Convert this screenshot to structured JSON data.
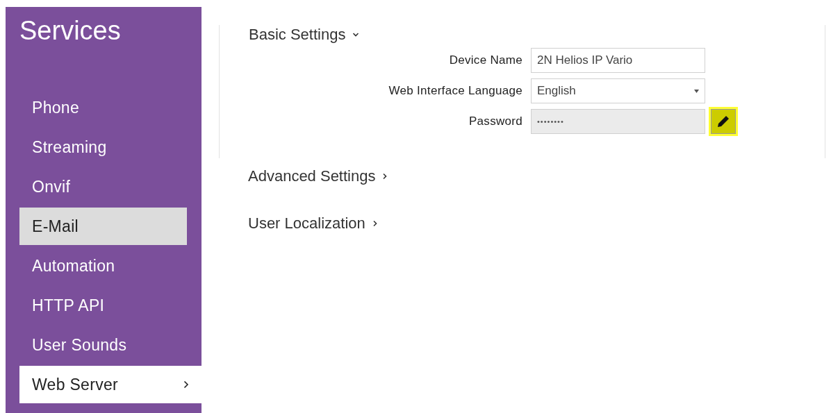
{
  "sidebar": {
    "title": "Services",
    "items": [
      {
        "label": "Phone",
        "selected": false,
        "highlighted": false
      },
      {
        "label": "Streaming",
        "selected": false,
        "highlighted": false
      },
      {
        "label": "Onvif",
        "selected": false,
        "highlighted": false
      },
      {
        "label": "E-Mail",
        "selected": false,
        "highlighted": true
      },
      {
        "label": "Automation",
        "selected": false,
        "highlighted": false
      },
      {
        "label": "HTTP API",
        "selected": false,
        "highlighted": false
      },
      {
        "label": "User Sounds",
        "selected": false,
        "highlighted": false
      },
      {
        "label": "Web Server",
        "selected": true,
        "highlighted": false
      }
    ]
  },
  "sections": [
    {
      "title": "Basic Settings",
      "expanded": true,
      "fields": [
        {
          "kind": "text",
          "label": "Device Name",
          "value": "2N Helios IP Vario"
        },
        {
          "kind": "select",
          "label": "Web Interface Language",
          "value": "English"
        },
        {
          "kind": "password",
          "label": "Password",
          "value": "••••••••",
          "disabled": true
        }
      ]
    },
    {
      "title": "Advanced Settings",
      "expanded": false
    },
    {
      "title": "User Localization",
      "expanded": false
    }
  ]
}
